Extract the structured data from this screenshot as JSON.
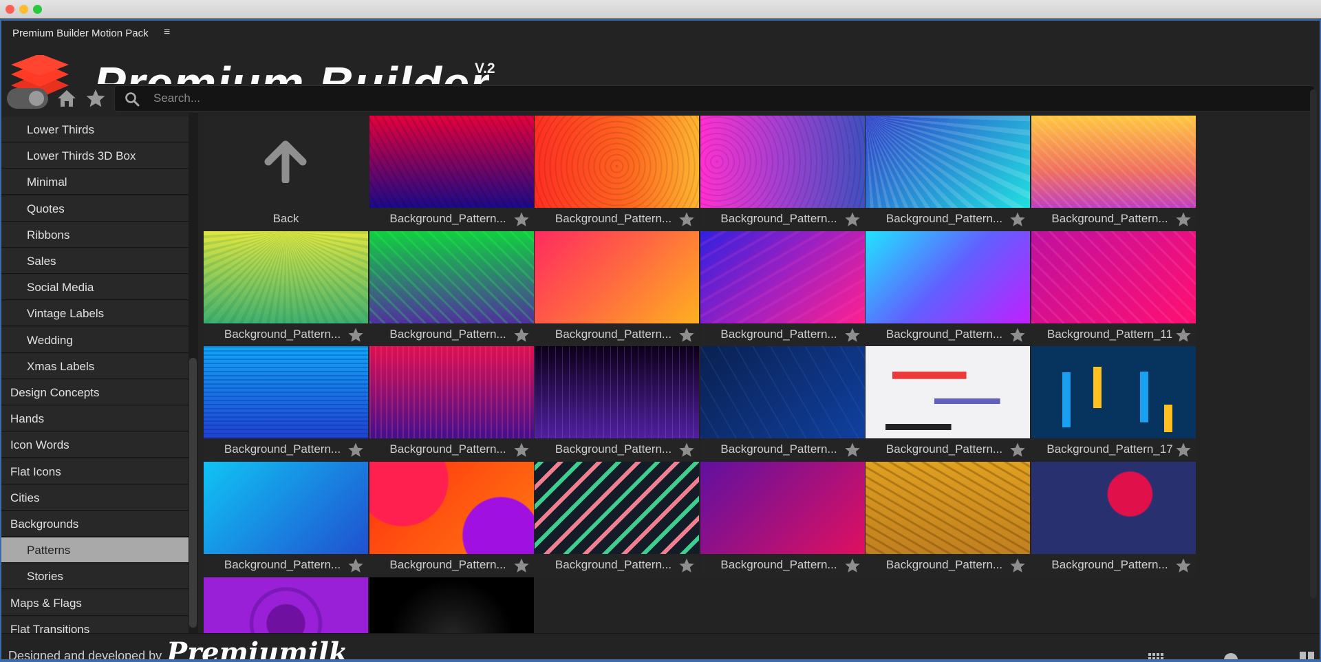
{
  "window": {
    "controls": [
      "close",
      "minimize",
      "maximize"
    ]
  },
  "panel": {
    "title": "Premium Builder Motion Pack",
    "menu_icon": "hamburger-icon"
  },
  "header": {
    "brand": "Premium Builder",
    "version": "V.2"
  },
  "toolbar": {
    "toggle_state": "on",
    "home_icon": "home-icon",
    "favorites_icon": "star-icon",
    "search_placeholder": "Search...",
    "search_value": ""
  },
  "sidebar": {
    "selected": "Patterns",
    "items": [
      {
        "label": "Lower Thirds",
        "level": "sub"
      },
      {
        "label": "Lower Thirds 3D Box",
        "level": "sub"
      },
      {
        "label": "Minimal",
        "level": "sub"
      },
      {
        "label": "Quotes",
        "level": "sub"
      },
      {
        "label": "Ribbons",
        "level": "sub"
      },
      {
        "label": "Sales",
        "level": "sub"
      },
      {
        "label": "Social Media",
        "level": "sub"
      },
      {
        "label": "Vintage Labels",
        "level": "sub"
      },
      {
        "label": "Wedding",
        "level": "sub"
      },
      {
        "label": "Xmas Labels",
        "level": "sub"
      },
      {
        "label": "Design Concepts",
        "level": "top"
      },
      {
        "label": "Hands",
        "level": "top"
      },
      {
        "label": "Icon Words",
        "level": "top"
      },
      {
        "label": "Flat Icons",
        "level": "top"
      },
      {
        "label": "Cities",
        "level": "top"
      },
      {
        "label": "Backgrounds",
        "level": "top"
      },
      {
        "label": "Patterns",
        "level": "sub",
        "selected": true
      },
      {
        "label": "Stories",
        "level": "sub"
      },
      {
        "label": "Maps & Flags",
        "level": "top"
      },
      {
        "label": "Flat Transitions",
        "level": "top"
      }
    ]
  },
  "grid": {
    "back_label": "Back",
    "tiles": [
      {
        "label": "Background_Pattern..."
      },
      {
        "label": "Background_Pattern..."
      },
      {
        "label": "Background_Pattern..."
      },
      {
        "label": "Background_Pattern..."
      },
      {
        "label": "Background_Pattern..."
      },
      {
        "label": "Background_Pattern..."
      },
      {
        "label": "Background_Pattern..."
      },
      {
        "label": "Background_Pattern..."
      },
      {
        "label": "Background_Pattern..."
      },
      {
        "label": "Background_Pattern..."
      },
      {
        "label": "Background_Pattern_11"
      },
      {
        "label": "Background_Pattern..."
      },
      {
        "label": "Background_Pattern..."
      },
      {
        "label": "Background_Pattern..."
      },
      {
        "label": "Background_Pattern..."
      },
      {
        "label": "Background_Pattern..."
      },
      {
        "label": "Background_Pattern_17"
      },
      {
        "label": "Background_Pattern..."
      },
      {
        "label": "Background_Pattern..."
      },
      {
        "label": "Background_Pattern..."
      },
      {
        "label": "Background_Pattern..."
      },
      {
        "label": "Background_Pattern..."
      },
      {
        "label": "Background_Pattern..."
      },
      {
        "label": ""
      },
      {
        "label": ""
      }
    ]
  },
  "footer": {
    "credit": "Designed and developed by",
    "logo_text": "Premiumilk"
  }
}
